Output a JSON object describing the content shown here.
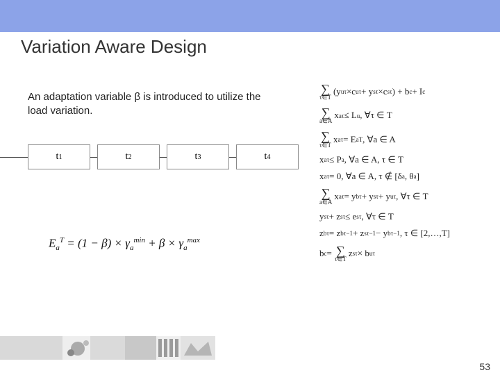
{
  "title": "Variation Aware Design",
  "intro": "An adaptation variable β is introduced to utilize the load variation.",
  "timeline": {
    "ticks": [
      "t1",
      "t2",
      "t3",
      "t4"
    ],
    "labels": {
      "t1": "t₁",
      "t2": "t₂",
      "t3": "t₃",
      "t4": "t₄"
    }
  },
  "main_equation": "EₐT = (1 − β) × γₐmin + β × γₐmax",
  "rhs_equations": [
    "Σ_{τ∈T} (yᵤτ × cᵤτ + yₛτ × cₛτ) + b_c + I_c",
    "Σ_{a∈A} xₐτ ≤ Lᵤ , ∀τ ∈ T",
    "Σ_{τ∈T} xₐτ = EₐT , ∀a ∈ A",
    "xₐτ ≤ Pₐ , ∀a ∈ A, τ ∈ T",
    "xₐτ = 0, ∀a ∈ A, τ ∉ [δₐ, θₐ]",
    "Σ_{a∈A} xₐτ = y_bτ + yₛτ + yᵤτ , ∀τ ∈ T",
    "yₛτ + zₛτ ≤ eₛτ , ∀τ ∈ T",
    "z_bτ = z_bτ⁻¹ + zₛτ⁻¹ − y_bτ⁻¹ , τ ∈ [2,…,T]",
    "b_c = Σ_{τ∈T} zₛτ × bᵤτ"
  ],
  "page_number": "53",
  "colors": {
    "header_band": "#8ca3e8"
  }
}
